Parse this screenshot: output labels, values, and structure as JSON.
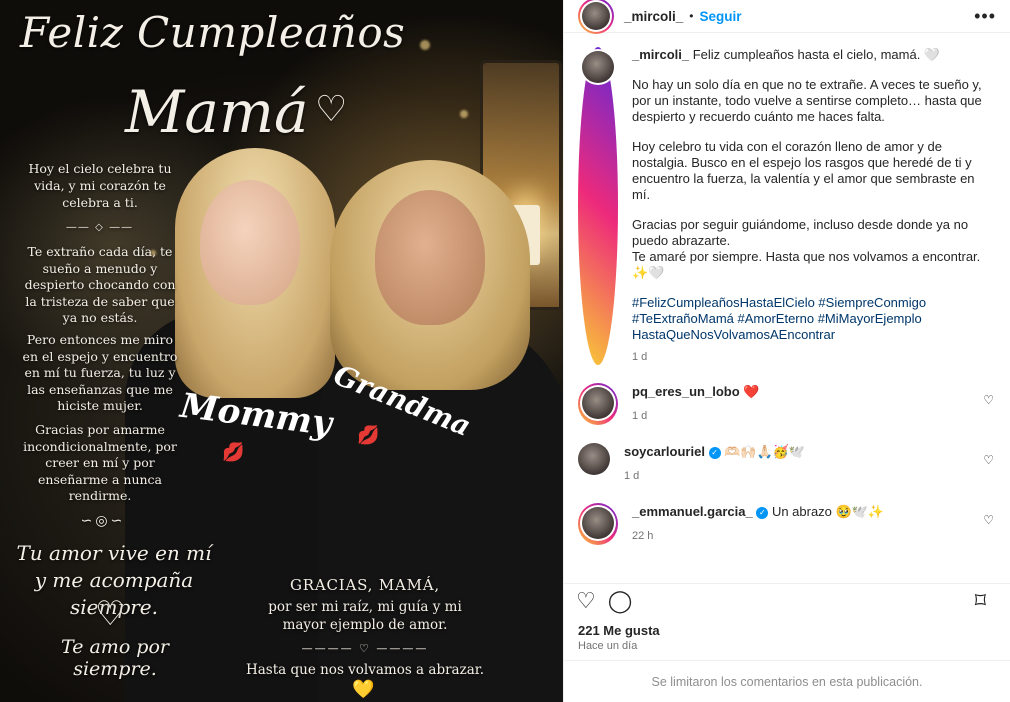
{
  "image": {
    "title_line1": "Feliz Cumpleaños",
    "title_line2": "Mamá",
    "heart_outline": "♡",
    "left_p1": "Hoy el cielo celebra tu vida, y mi corazón te celebra a ti.",
    "left_p2": "Te extraño cada día, te sueño a menudo y despierto chocando con la tristeza de saber que ya no estás.",
    "left_p3": "Pero entonces me miro en el espejo y encuentro en mí tu fuerza, tu luz y las enseñanzas que me hiciste mujer.",
    "left_p4": "Gracias por amarme incondicionalmente, por creer en mí y por enseñarme a nunca rendirme.",
    "script_line": "Tu amor vive en mí y me acompaña siempre.",
    "script_love": "Te amo por siempre.",
    "gracias_title": "GRACIAS, MAMÁ,",
    "gracias_body": "por ser mi raíz, mi guía y mi mayor ejemplo de amor.",
    "hasta": "Hasta que nos volvamos a abrazar.",
    "yellow_heart": "💛",
    "shirt_left": "Mommy",
    "shirt_right": "Grandma"
  },
  "header": {
    "username": "_mircoli_",
    "separator": "•",
    "follow_label": "Seguir",
    "more_label": "•••"
  },
  "caption": {
    "username": "_mircoli_",
    "first_line": "Feliz cumpleaños hasta el cielo, mamá. 🤍",
    "para1": "No hay un solo día en que no te extrañe. A veces te sueño y, por un instante, todo vuelve a sentirse completo… hasta que despierto y recuerdo cuánto me haces falta.",
    "para2": "Hoy celebro tu vida con el corazón lleno de amor y de nostalgia. Busco en el espejo los rasgos que heredé de ti y encuentro la fuerza, la valentía y el amor que sembraste en mí.",
    "para3a": "Gracias por seguir guiándome, incluso desde donde ya no puedo abrazarte.",
    "para3b": "Te amaré por siempre. Hasta que nos volvamos a encontrar. ✨🤍",
    "hashtags": "#FelizCumpleañosHastaElCielo #SiempreConmigo #TeExtrañoMamá #AmorEterno #MiMayorEjemplo HastaQueNosVolvamosAEncontrar",
    "time": "1 d"
  },
  "comments": [
    {
      "username": "pq_eres_un_lobo",
      "text": "❤️",
      "time": "1 d",
      "verified": false
    },
    {
      "username": "soycarlouriel",
      "text": "🫶🏻🙌🏻🙏🏻🥳🕊️",
      "time": "1 d",
      "verified": true
    },
    {
      "username": "_emmanuel.garcia_",
      "text": "Un abrazo 🥹🕊️✨",
      "time": "22 h",
      "verified": true
    }
  ],
  "icons": {
    "like": "♡",
    "comment": "◯",
    "bookmark": "⌑",
    "verified": "✓"
  },
  "footer": {
    "likes": "221 Me gusta",
    "ago": "Hace un día",
    "limited": "Se limitaron los comentarios en esta publicación."
  }
}
